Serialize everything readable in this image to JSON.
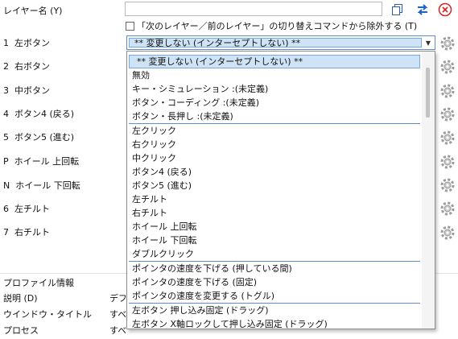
{
  "layer_name_label": "レイヤー名 (Y)",
  "layer_name_value": "",
  "exclude_checkbox": {
    "label": "「次のレイヤー／前のレイヤー」の切り替えコマンドから除外する (T)",
    "checked": false
  },
  "toolbar_icons": [
    "copy-icon",
    "swap-icon",
    "delete-icon"
  ],
  "buttons": [
    {
      "key": "1",
      "label": "左ボタン"
    },
    {
      "key": "2",
      "label": "右ボタン"
    },
    {
      "key": "3",
      "label": "中ボタン"
    },
    {
      "key": "4",
      "label": "ボタン4 (戻る)"
    },
    {
      "key": "5",
      "label": "ボタン5 (進む)"
    },
    {
      "key": "P",
      "label": "ホイール 上回転"
    },
    {
      "key": "N",
      "label": "ホイール 下回転"
    },
    {
      "key": "6",
      "label": "左チルト"
    },
    {
      "key": "7",
      "label": "右チルト"
    }
  ],
  "combo_selected": "** 変更しない (インターセプトしない) **",
  "dropdown_items": [
    "** 変更しない (インターセプトしない) **",
    "無効",
    "キー・シミュレーション :(未定義)",
    "ボタン・コーディング :(未定義)",
    "ボタン・長押し :(未定義)",
    "左クリック",
    "右クリック",
    "中クリック",
    "ボタン4 (戻る)",
    "ボタン5 (進む)",
    "左チルト",
    "右チルト",
    "ホイール 上回転",
    "ホイール 下回転",
    "ダブルクリック",
    "ポインタの速度を下げる (押している間)",
    "ポインタの速度を下げる (固定)",
    "ポインタの速度を変更する (トグル)",
    "左ボタン 押し込み固定 (ドラッグ)",
    "左ボタン X軸ロックして押し込み固定 (ドラッグ)"
  ],
  "profile": {
    "header": "プロファイル情報",
    "rows": [
      {
        "label": "説明 (D)",
        "value": "デフォ"
      },
      {
        "label": "ウインドウ・タイトル",
        "value": "すべて"
      },
      {
        "label": "プロセス",
        "value": "すべて"
      }
    ]
  }
}
